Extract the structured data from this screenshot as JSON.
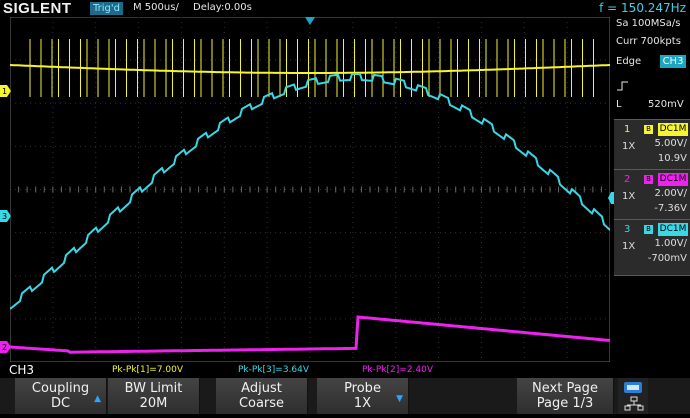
{
  "topbar": {
    "brand": "SIGLENT",
    "trigger_status": "Trig'd",
    "timebase": "M 500us/",
    "delay": "Delay:0.00s",
    "frequency": "f = 150.247Hz"
  },
  "right_panel": {
    "sample_rate": "Sa 100MSa/s",
    "curr": "Curr 700kpts",
    "trigger_mode": "Edge",
    "trigger_source": "CH3",
    "trigger_level_label": "L",
    "trigger_level": "520mV"
  },
  "channels": [
    {
      "num": "1",
      "bw": "B",
      "coupling": "DC1M",
      "probe": "1X",
      "vdiv": "5.00V/",
      "offset": "10.9V",
      "color": "#f5f531"
    },
    {
      "num": "2",
      "bw": "B",
      "coupling": "DC1M",
      "probe": "1X",
      "vdiv": "2.00V/",
      "offset": "-7.36V",
      "color": "#ee22ee"
    },
    {
      "num": "3",
      "bw": "B",
      "coupling": "DC1M",
      "probe": "1X",
      "vdiv": "1.00V/",
      "offset": "-700mV",
      "color": "#3ad7e6"
    }
  ],
  "markers": {
    "ch1": "1",
    "ch2": "2",
    "ch3": "3"
  },
  "active_channel": "CH3",
  "measurements": [
    {
      "label": "Pk-Pk[1]=7.00V",
      "color": "#f5f531"
    },
    {
      "label": "Pk-Pk[3]=3.64V",
      "color": "#3ad7e6"
    },
    {
      "label": "Pk-Pk[2]=2.40V",
      "color": "#ee22ee"
    }
  ],
  "softkeys": [
    {
      "title": "Coupling",
      "value": "DC"
    },
    {
      "title": "BW Limit",
      "value": "20M"
    },
    {
      "title": "Adjust",
      "value": "Coarse"
    },
    {
      "title": "Probe",
      "value": "1X"
    },
    {
      "title": "Next Page",
      "value": "Page 1/3"
    }
  ],
  "icons": {
    "usb": "usb-icon",
    "network": "network-icon"
  }
}
